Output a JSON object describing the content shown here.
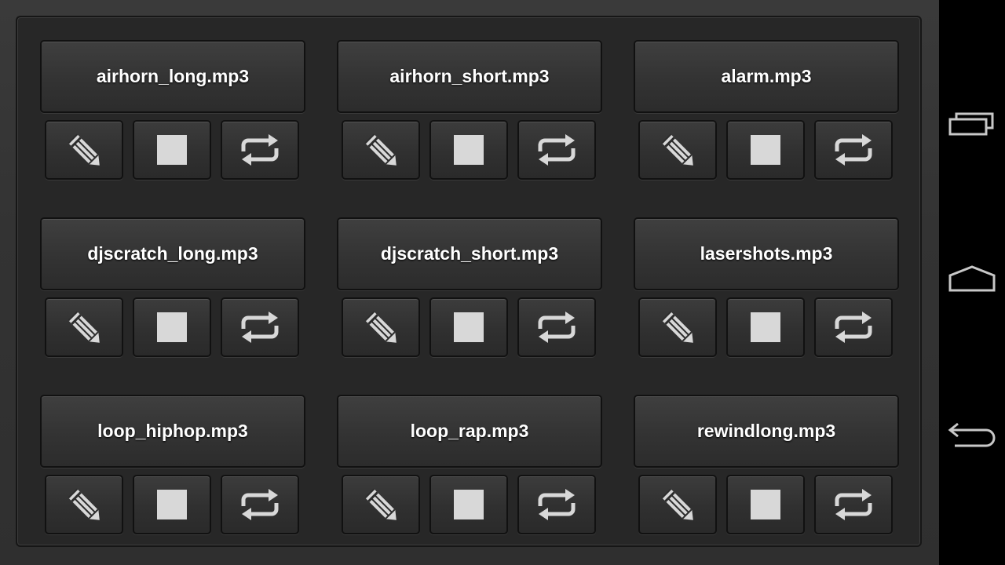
{
  "sounds": [
    {
      "label": "airhorn_long.mp3"
    },
    {
      "label": "airhorn_short.mp3"
    },
    {
      "label": "alarm.mp3"
    },
    {
      "label": "djscratch_long.mp3"
    },
    {
      "label": "djscratch_short.mp3"
    },
    {
      "label": "lasershots.mp3"
    },
    {
      "label": "loop_hiphop.mp3"
    },
    {
      "label": "loop_rap.mp3"
    },
    {
      "label": "rewindlong.mp3"
    }
  ],
  "controls": {
    "edit_icon": "pencil-icon",
    "stop_icon": "stop-icon",
    "loop_icon": "repeat-icon"
  },
  "navbar": {
    "recents_icon": "recent-apps-icon",
    "home_icon": "home-icon",
    "back_icon": "back-icon"
  },
  "colors": {
    "icon": "#d8d8d8",
    "nav_icon": "#c8c8c8",
    "button_text": "#ffffff"
  }
}
